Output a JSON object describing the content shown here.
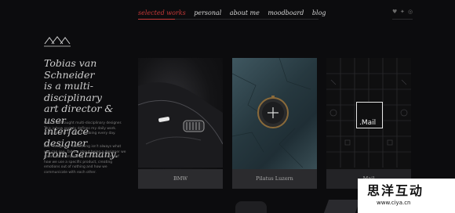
{
  "nav": {
    "items": [
      "selected works",
      "personal",
      "about me",
      "moodboard",
      "blog"
    ],
    "active_color": "#c93a3a"
  },
  "social": {
    "icons": [
      "heart-icon",
      "twitter-icon",
      "dribbble-icon"
    ]
  },
  "hero": {
    "line1": "Tobias van Schneider",
    "line2": "is a multi-disciplinary",
    "line3": "art director & user",
    "line4": "interface designer",
    "line5": "from Germany."
  },
  "bio": {
    "p1_l1": "I am a self-taught multi-disciplinary designer.",
    "p1_l2": "This is how society defines my daily work.",
    "p1_l3": "And yes, this is what I'm doing every day.",
    "p2_l1": "But \"designing\" something isn't always what",
    "p2_l2": "you can see. Talking about being a designer we",
    "p2_l3": "speak about improving our lives in terms of",
    "p2_l4": "how we use a specific product, creating",
    "p2_l5": "emotions out of nothing and how we",
    "p2_l6": "communicate with each other."
  },
  "cards": [
    {
      "caption": "BMW"
    },
    {
      "caption": "Pilatus Luzern"
    },
    {
      "caption": "Mail",
      "logo": ".Mail"
    }
  ],
  "watermark": {
    "cn": "思洋互动",
    "url": "www.ciya.cn"
  }
}
